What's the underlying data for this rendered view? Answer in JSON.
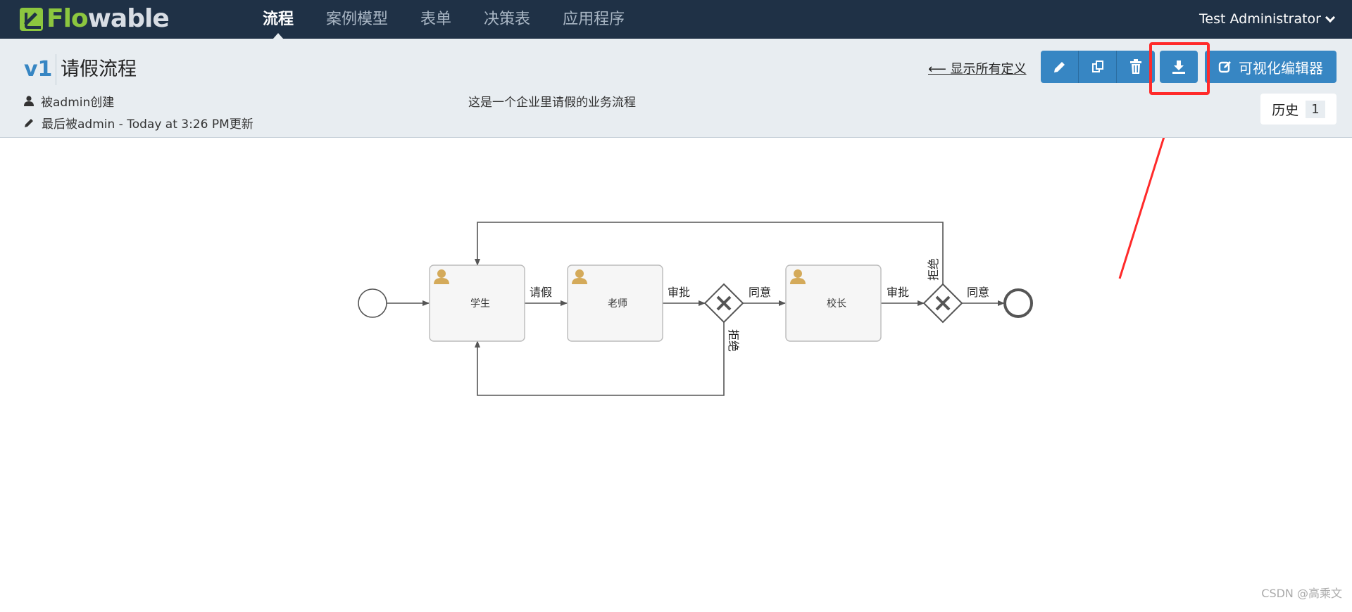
{
  "app": {
    "logo_text_green": "Flo",
    "logo_text_rest": "wable"
  },
  "nav": {
    "items": [
      {
        "label": "流程",
        "active": true
      },
      {
        "label": "案例模型",
        "active": false
      },
      {
        "label": "表单",
        "active": false
      },
      {
        "label": "决策表",
        "active": false
      },
      {
        "label": "应用程序",
        "active": false
      }
    ],
    "user": "Test Administrator"
  },
  "model": {
    "version": "v1",
    "title": "请假流程",
    "created_by": "被admin创建",
    "updated": "最后被admin - Today at 3:26 PM更新",
    "description": "这是一个企业里请假的业务流程"
  },
  "actions": {
    "back_label": "⟵ 显示所有定义",
    "editor_label": "可视化编辑器",
    "history_label": "历史",
    "history_count": "1"
  },
  "diagram": {
    "tasks": [
      "学生",
      "老师",
      "校长"
    ],
    "flows": {
      "request": "请假",
      "approve_1": "审批",
      "agree_1": "同意",
      "reject_1": "拒绝",
      "approve_2": "审批",
      "agree_2": "同意",
      "reject_2": "拒绝"
    }
  },
  "colors": {
    "navbar": "#1f3146",
    "brand_green": "#8cc63f",
    "primary_button": "#3786c3",
    "highlight": "#ff2a2a",
    "task_icon": "#d4aa5a"
  },
  "watermark": "CSDN @高乘文"
}
